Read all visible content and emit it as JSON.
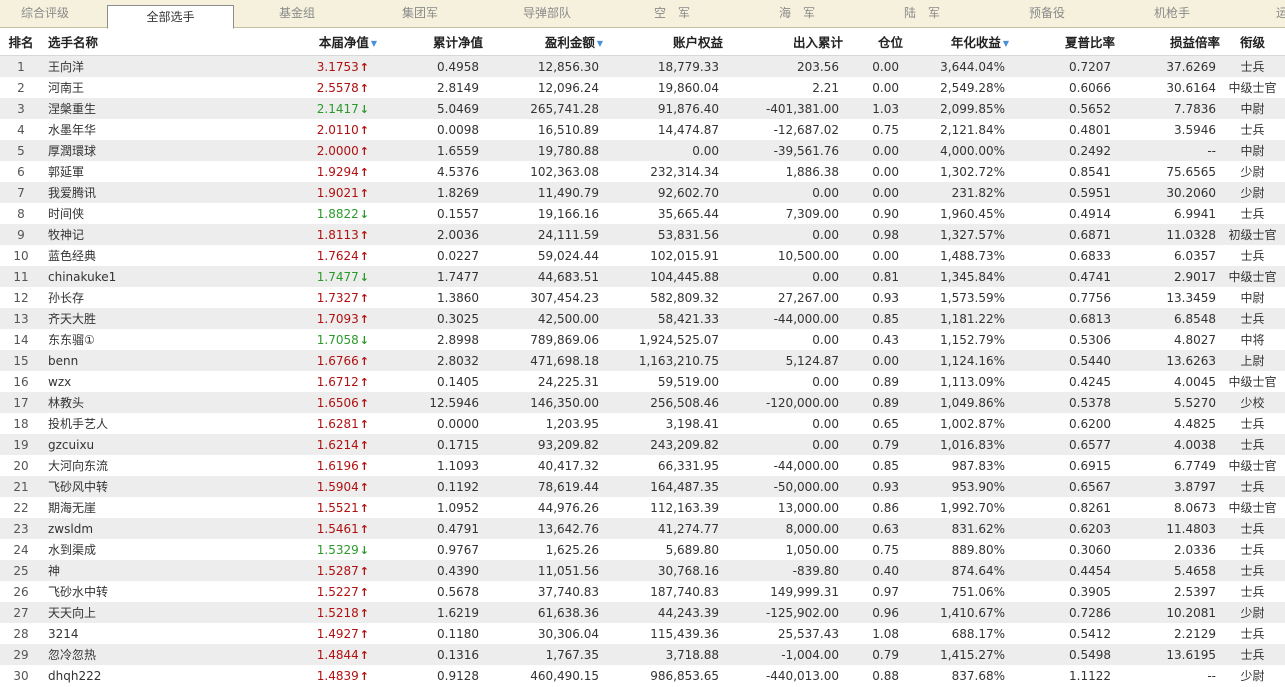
{
  "tabs": [
    {
      "label": "综合评级",
      "active": false
    },
    {
      "label": "全部选手",
      "active": true
    },
    {
      "label": "基金组",
      "active": false
    },
    {
      "label": "集团军",
      "active": false
    },
    {
      "label": "导弹部队",
      "active": false
    },
    {
      "label": "空　军",
      "active": false
    },
    {
      "label": "海　军",
      "active": false
    },
    {
      "label": "陆　军",
      "active": false
    },
    {
      "label": "预备役",
      "active": false
    },
    {
      "label": "机枪手",
      "active": false
    },
    {
      "label": "运",
      "active": false
    }
  ],
  "columns": {
    "rank": "排名",
    "name": "选手名称",
    "nav": "本届净值",
    "cum": "累计净值",
    "profit": "盈利金额",
    "equity": "账户权益",
    "flow": "出入累计",
    "pos": "仓位",
    "annual": "年化收益",
    "sharpe": "夏普比率",
    "pl": "损益倍率",
    "title": "衔级"
  },
  "sort_marker": "▼",
  "colors": {
    "up": "#b01010",
    "down": "#2a9a2a",
    "tabbar": "#f6f1dd",
    "row_alt": "#ededed",
    "sort": "#4a8fd8"
  },
  "rows": [
    {
      "rank": "1",
      "name": "王向洋",
      "nav": "3.1753",
      "dir": "up",
      "cum": "0.4958",
      "profit": "12,856.30",
      "equity": "18,779.33",
      "flow": "203.56",
      "pos": "0.00",
      "annual": "3,644.04%",
      "sharpe": "0.7207",
      "pl": "37.6269",
      "title": "士兵"
    },
    {
      "rank": "2",
      "name": "河南王",
      "nav": "2.5578",
      "dir": "up",
      "cum": "2.8149",
      "profit": "12,096.24",
      "equity": "19,860.04",
      "flow": "2.21",
      "pos": "0.00",
      "annual": "2,549.28%",
      "sharpe": "0.6066",
      "pl": "30.6164",
      "title": "中级士官"
    },
    {
      "rank": "3",
      "name": "涅槃重生",
      "nav": "2.1417",
      "dir": "down",
      "cum": "5.0469",
      "profit": "265,741.28",
      "equity": "91,876.40",
      "flow": "-401,381.00",
      "pos": "1.03",
      "annual": "2,099.85%",
      "sharpe": "0.5652",
      "pl": "7.7836",
      "title": "中尉"
    },
    {
      "rank": "4",
      "name": "水墨年华",
      "nav": "2.0110",
      "dir": "up",
      "cum": "0.0098",
      "profit": "16,510.89",
      "equity": "14,474.87",
      "flow": "-12,687.02",
      "pos": "0.75",
      "annual": "2,121.84%",
      "sharpe": "0.4801",
      "pl": "3.5946",
      "title": "士兵"
    },
    {
      "rank": "5",
      "name": "厚潤環球",
      "nav": "2.0000",
      "dir": "up",
      "cum": "1.6559",
      "profit": "19,780.88",
      "equity": "0.00",
      "flow": "-39,561.76",
      "pos": "0.00",
      "annual": "4,000.00%",
      "sharpe": "0.2492",
      "pl": "--",
      "title": "中尉"
    },
    {
      "rank": "6",
      "name": "郭延軍",
      "nav": "1.9294",
      "dir": "up",
      "cum": "4.5376",
      "profit": "102,363.08",
      "equity": "232,314.34",
      "flow": "1,886.38",
      "pos": "0.00",
      "annual": "1,302.72%",
      "sharpe": "0.8541",
      "pl": "75.6565",
      "title": "少尉"
    },
    {
      "rank": "7",
      "name": "我爱腾讯",
      "nav": "1.9021",
      "dir": "up",
      "cum": "1.8269",
      "profit": "11,490.79",
      "equity": "92,602.70",
      "flow": "0.00",
      "pos": "0.00",
      "annual": "231.82%",
      "sharpe": "0.5951",
      "pl": "30.2060",
      "title": "少尉"
    },
    {
      "rank": "8",
      "name": "时间侠",
      "nav": "1.8822",
      "dir": "down",
      "cum": "0.1557",
      "profit": "19,166.16",
      "equity": "35,665.44",
      "flow": "7,309.00",
      "pos": "0.90",
      "annual": "1,960.45%",
      "sharpe": "0.4914",
      "pl": "6.9941",
      "title": "士兵"
    },
    {
      "rank": "9",
      "name": "牧神记",
      "nav": "1.8113",
      "dir": "up",
      "cum": "2.0036",
      "profit": "24,111.59",
      "equity": "53,831.56",
      "flow": "0.00",
      "pos": "0.98",
      "annual": "1,327.57%",
      "sharpe": "0.6871",
      "pl": "11.0328",
      "title": "初级士官"
    },
    {
      "rank": "10",
      "name": "蓝色经典",
      "nav": "1.7624",
      "dir": "up",
      "cum": "0.0227",
      "profit": "59,024.44",
      "equity": "102,015.91",
      "flow": "10,500.00",
      "pos": "0.00",
      "annual": "1,488.73%",
      "sharpe": "0.6833",
      "pl": "6.0357",
      "title": "士兵"
    },
    {
      "rank": "11",
      "name": "chinakuke1",
      "nav": "1.7477",
      "dir": "down",
      "cum": "1.7477",
      "profit": "44,683.51",
      "equity": "104,445.88",
      "flow": "0.00",
      "pos": "0.81",
      "annual": "1,345.84%",
      "sharpe": "0.4741",
      "pl": "2.9017",
      "title": "中级士官"
    },
    {
      "rank": "12",
      "name": "孙长存",
      "nav": "1.7327",
      "dir": "up",
      "cum": "1.3860",
      "profit": "307,454.23",
      "equity": "582,809.32",
      "flow": "27,267.00",
      "pos": "0.93",
      "annual": "1,573.59%",
      "sharpe": "0.7756",
      "pl": "13.3459",
      "title": "中尉"
    },
    {
      "rank": "13",
      "name": "齐天大胜",
      "nav": "1.7093",
      "dir": "up",
      "cum": "0.3025",
      "profit": "42,500.00",
      "equity": "58,421.33",
      "flow": "-44,000.00",
      "pos": "0.85",
      "annual": "1,181.22%",
      "sharpe": "0.6813",
      "pl": "6.8548",
      "title": "士兵"
    },
    {
      "rank": "14",
      "name": "东东骝①",
      "nav": "1.7058",
      "dir": "down",
      "cum": "2.8998",
      "profit": "789,869.06",
      "equity": "1,924,525.07",
      "flow": "0.00",
      "pos": "0.43",
      "annual": "1,152.79%",
      "sharpe": "0.5306",
      "pl": "4.8027",
      "title": "中将"
    },
    {
      "rank": "15",
      "name": "benn",
      "nav": "1.6766",
      "dir": "up",
      "cum": "2.8032",
      "profit": "471,698.18",
      "equity": "1,163,210.75",
      "flow": "5,124.87",
      "pos": "0.00",
      "annual": "1,124.16%",
      "sharpe": "0.5440",
      "pl": "13.6263",
      "title": "上尉"
    },
    {
      "rank": "16",
      "name": "wzx",
      "nav": "1.6712",
      "dir": "up",
      "cum": "0.1405",
      "profit": "24,225.31",
      "equity": "59,519.00",
      "flow": "0.00",
      "pos": "0.89",
      "annual": "1,113.09%",
      "sharpe": "0.4245",
      "pl": "4.0045",
      "title": "中级士官"
    },
    {
      "rank": "17",
      "name": "林教头",
      "nav": "1.6506",
      "dir": "up",
      "cum": "12.5946",
      "profit": "146,350.00",
      "equity": "256,508.46",
      "flow": "-120,000.00",
      "pos": "0.89",
      "annual": "1,049.86%",
      "sharpe": "0.5378",
      "pl": "5.5270",
      "title": "少校"
    },
    {
      "rank": "18",
      "name": "投机手艺人",
      "nav": "1.6281",
      "dir": "up",
      "cum": "0.0000",
      "profit": "1,203.95",
      "equity": "3,198.41",
      "flow": "0.00",
      "pos": "0.65",
      "annual": "1,002.87%",
      "sharpe": "0.6200",
      "pl": "4.4825",
      "title": "士兵"
    },
    {
      "rank": "19",
      "name": "gzcuixu",
      "nav": "1.6214",
      "dir": "up",
      "cum": "0.1715",
      "profit": "93,209.82",
      "equity": "243,209.82",
      "flow": "0.00",
      "pos": "0.79",
      "annual": "1,016.83%",
      "sharpe": "0.6577",
      "pl": "4.0038",
      "title": "士兵"
    },
    {
      "rank": "20",
      "name": "大河向东流",
      "nav": "1.6196",
      "dir": "up",
      "cum": "1.1093",
      "profit": "40,417.32",
      "equity": "66,331.95",
      "flow": "-44,000.00",
      "pos": "0.85",
      "annual": "987.83%",
      "sharpe": "0.6915",
      "pl": "6.7749",
      "title": "中级士官"
    },
    {
      "rank": "21",
      "name": "飞砂风中转",
      "nav": "1.5904",
      "dir": "up",
      "cum": "0.1192",
      "profit": "78,619.44",
      "equity": "164,487.35",
      "flow": "-50,000.00",
      "pos": "0.93",
      "annual": "953.90%",
      "sharpe": "0.6567",
      "pl": "3.8797",
      "title": "士兵"
    },
    {
      "rank": "22",
      "name": "期海无崖",
      "nav": "1.5521",
      "dir": "up",
      "cum": "1.0952",
      "profit": "44,976.26",
      "equity": "112,163.39",
      "flow": "13,000.00",
      "pos": "0.86",
      "annual": "1,992.70%",
      "sharpe": "0.8261",
      "pl": "8.0673",
      "title": "中级士官"
    },
    {
      "rank": "23",
      "name": "zwsldm",
      "nav": "1.5461",
      "dir": "up",
      "cum": "0.4791",
      "profit": "13,642.76",
      "equity": "41,274.77",
      "flow": "8,000.00",
      "pos": "0.63",
      "annual": "831.62%",
      "sharpe": "0.6203",
      "pl": "11.4803",
      "title": "士兵"
    },
    {
      "rank": "24",
      "name": "水到渠成",
      "nav": "1.5329",
      "dir": "down",
      "cum": "0.9767",
      "profit": "1,625.26",
      "equity": "5,689.80",
      "flow": "1,050.00",
      "pos": "0.75",
      "annual": "889.80%",
      "sharpe": "0.3060",
      "pl": "2.0336",
      "title": "士兵"
    },
    {
      "rank": "25",
      "name": "神",
      "nav": "1.5287",
      "dir": "up",
      "cum": "0.4390",
      "profit": "11,051.56",
      "equity": "30,768.16",
      "flow": "-839.80",
      "pos": "0.40",
      "annual": "874.64%",
      "sharpe": "0.4454",
      "pl": "5.4658",
      "title": "士兵"
    },
    {
      "rank": "26",
      "name": "飞砂水中转",
      "nav": "1.5227",
      "dir": "up",
      "cum": "0.5678",
      "profit": "37,740.83",
      "equity": "187,740.83",
      "flow": "149,999.31",
      "pos": "0.97",
      "annual": "751.06%",
      "sharpe": "0.3905",
      "pl": "2.5397",
      "title": "士兵"
    },
    {
      "rank": "27",
      "name": "天天向上",
      "nav": "1.5218",
      "dir": "up",
      "cum": "1.6219",
      "profit": "61,638.36",
      "equity": "44,243.39",
      "flow": "-125,902.00",
      "pos": "0.96",
      "annual": "1,410.67%",
      "sharpe": "0.7286",
      "pl": "10.2081",
      "title": "少尉"
    },
    {
      "rank": "28",
      "name": "3214",
      "nav": "1.4927",
      "dir": "up",
      "cum": "0.1180",
      "profit": "30,306.04",
      "equity": "115,439.36",
      "flow": "25,537.43",
      "pos": "1.08",
      "annual": "688.17%",
      "sharpe": "0.5412",
      "pl": "2.2129",
      "title": "士兵"
    },
    {
      "rank": "29",
      "name": "忽冷忽热",
      "nav": "1.4844",
      "dir": "up",
      "cum": "0.1316",
      "profit": "1,767.35",
      "equity": "3,718.88",
      "flow": "-1,004.00",
      "pos": "0.79",
      "annual": "1,415.27%",
      "sharpe": "0.5498",
      "pl": "13.6195",
      "title": "士兵"
    },
    {
      "rank": "30",
      "name": "dhqh222",
      "nav": "1.4839",
      "dir": "up",
      "cum": "0.9128",
      "profit": "460,490.15",
      "equity": "986,853.65",
      "flow": "-440,013.00",
      "pos": "0.88",
      "annual": "837.68%",
      "sharpe": "1.1122",
      "pl": "--",
      "title": "少尉"
    }
  ]
}
